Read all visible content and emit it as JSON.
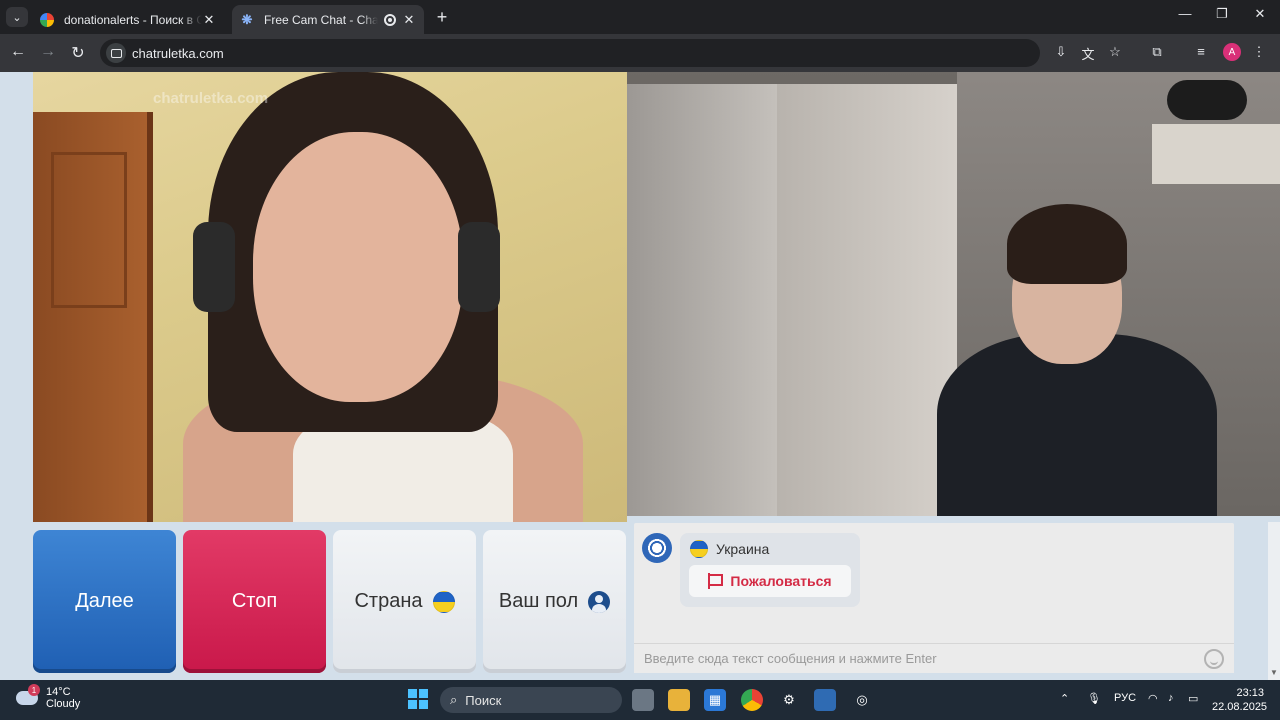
{
  "browser": {
    "tabs": [
      {
        "title": "donationalerts - Поиск в Google",
        "active": false
      },
      {
        "title": "Free Cam Chat - Chatruletka",
        "active": true
      }
    ],
    "url": "chatruletka.com",
    "profile_initial": "A"
  },
  "page": {
    "watermark": "chatruletka.com",
    "buttons": {
      "next": "Далее",
      "stop": "Стоп",
      "country": "Страна",
      "gender": "Ваш пол"
    },
    "chat": {
      "partner_country": "Украина",
      "report_label": "Пожаловаться",
      "input_placeholder": "Введите сюда текст сообщения и нажмите Enter"
    }
  },
  "taskbar": {
    "weather_temp": "14°C",
    "weather_desc": "Cloudy",
    "weather_badge": "1",
    "search_placeholder": "Поиск",
    "language": "РУС",
    "time": "23:13",
    "date": "22.08.2025"
  },
  "colors": {
    "next_button": "#2a6cc0",
    "stop_button": "#d4214f",
    "report_text": "#d42b45"
  }
}
